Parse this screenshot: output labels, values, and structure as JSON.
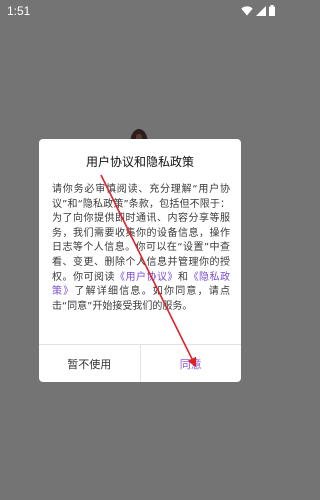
{
  "status_bar": {
    "time": "1:51",
    "icons": [
      "wifi-icon",
      "signal-icon",
      "battery-icon"
    ]
  },
  "dialog": {
    "title": "用户协议和隐私政策",
    "body_segments": [
      "请你务必审慎阅读、充分理解“用户协议”和“隐私政策”条款，包括但不限于：为了向你提供即时通讯、内容分享等服务，我们需要收集你的设备信息，操作日志等个人信息。你可以在“设置”中查看、变更、删除个人信息并管理你的授权。你可阅读",
      "《用户协议》",
      "和",
      "《隐私政策》",
      "了解详细信息。如你同意，请点击“同意”开始接受我们的服务。"
    ],
    "decline_label": "暂不使用",
    "agree_label": "同意"
  },
  "colors": {
    "link": "#7a4fd0",
    "agree": "#8a5fe0",
    "annotation_arrow": "#e0212b",
    "backdrop": "#747474"
  }
}
